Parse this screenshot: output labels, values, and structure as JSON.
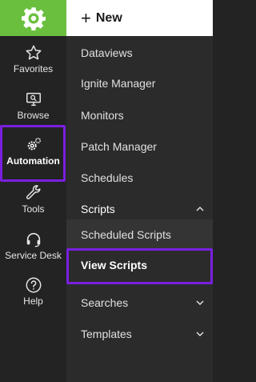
{
  "colors": {
    "brand_green": "#6abf3f",
    "rail_bg": "#232323",
    "panel_bg": "#2b2b2b",
    "highlight": "#7a1fe0"
  },
  "logo": {
    "icon": "gear-logo-icon"
  },
  "rail": {
    "items": [
      {
        "label": "Favorites",
        "icon": "star-icon"
      },
      {
        "label": "Browse",
        "icon": "monitor-search-icon"
      },
      {
        "label": "Automation",
        "icon": "gears-icon",
        "active": true
      },
      {
        "label": "Tools",
        "icon": "wrench-icon"
      },
      {
        "label": "Service Desk",
        "icon": "headset-icon"
      },
      {
        "label": "Help",
        "icon": "help-circle-icon"
      }
    ]
  },
  "new_button": {
    "icon": "plus-icon",
    "label": "New"
  },
  "menu": {
    "items": [
      {
        "label": "Dataviews"
      },
      {
        "label": "Ignite Manager"
      },
      {
        "label": "Monitors"
      },
      {
        "label": "Patch Manager"
      },
      {
        "label": "Schedules"
      },
      {
        "label": "Scripts",
        "expanded": true,
        "children": [
          {
            "label": "Scheduled Scripts"
          },
          {
            "label": "View Scripts",
            "active": true
          }
        ]
      },
      {
        "label": "Searches",
        "expanded": false
      },
      {
        "label": "Templates",
        "expanded": false
      }
    ]
  }
}
